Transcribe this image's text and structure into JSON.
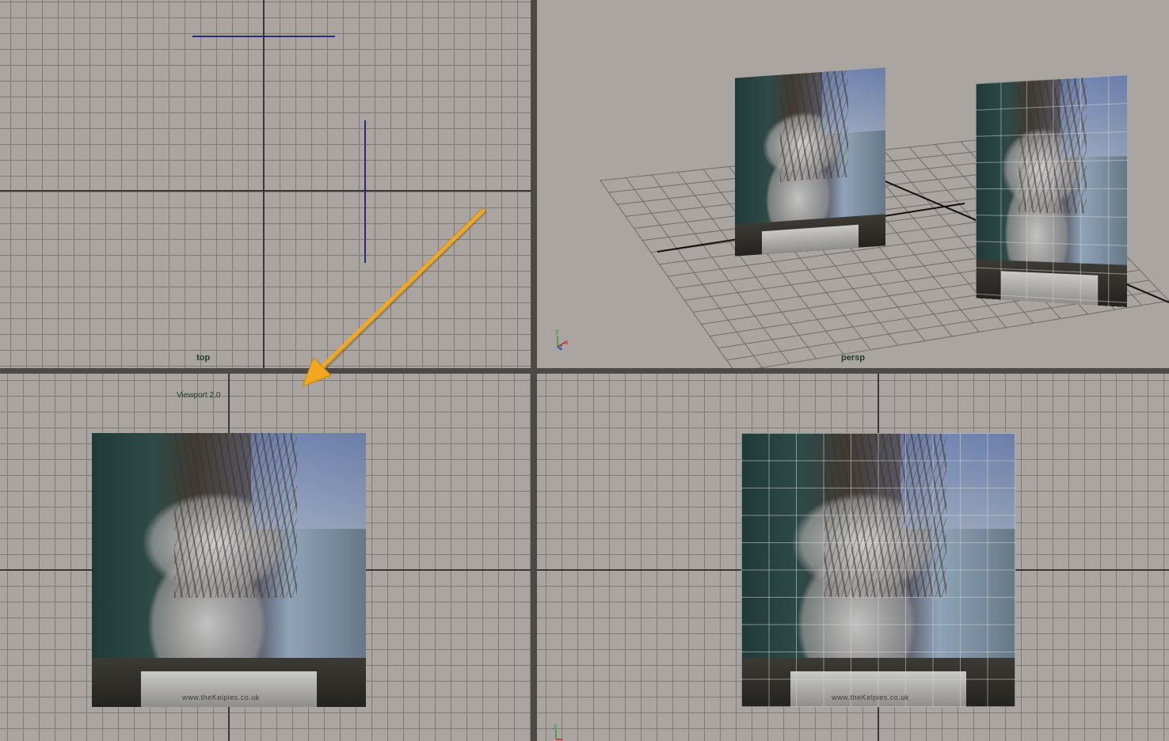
{
  "viewports": {
    "top": {
      "label": "top"
    },
    "persp": {
      "label": "persp"
    },
    "side": {
      "info": "Viewport 2.0"
    },
    "front": {}
  },
  "axis_indicator": {
    "y": "y",
    "x": "x",
    "z": "z"
  },
  "photo": {
    "caption": "www.theKelpies.co.uk"
  },
  "colors": {
    "viewport_bg": "#aaa5a0",
    "grid_line": "#7f7c78",
    "axis_line": "#3a3836",
    "label_green": "#1f3b22",
    "arrow_orange": "#f2a81e",
    "splitter": "#4b4a48"
  }
}
